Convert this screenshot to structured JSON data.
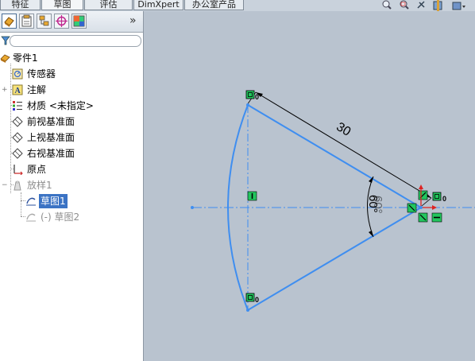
{
  "command_tabs": [
    {
      "label": "特征",
      "active": false
    },
    {
      "label": "草图",
      "active": true
    },
    {
      "label": "评估",
      "active": false
    },
    {
      "label": "DimXpert",
      "active": false
    },
    {
      "label": "办公室产品",
      "active": false
    }
  ],
  "panel_tabs": [
    {
      "icon": "feature-manager-icon",
      "active": true
    },
    {
      "icon": "property-manager-icon",
      "active": false
    },
    {
      "icon": "configuration-manager-icon",
      "active": false
    },
    {
      "icon": "dimxpert-manager-icon",
      "active": false
    },
    {
      "icon": "display-manager-icon",
      "active": false
    }
  ],
  "panel_more": "»",
  "tree": {
    "root": "零件1",
    "items": [
      {
        "label": "传感器",
        "icon": "sensor-icon"
      },
      {
        "label": "注解",
        "icon": "annotation-icon"
      },
      {
        "label": "材质 <未指定>",
        "icon": "material-icon"
      },
      {
        "label": "前视基准面",
        "icon": "plane-icon"
      },
      {
        "label": "上视基准面",
        "icon": "plane-icon"
      },
      {
        "label": "右视基准面",
        "icon": "plane-icon"
      },
      {
        "label": "原点",
        "icon": "origin-icon"
      },
      {
        "label": "放样1",
        "icon": "loft-icon",
        "muted": true
      },
      {
        "label": "草图1",
        "icon": "sketch-icon",
        "selected": true
      },
      {
        "label": "(-) 草图2",
        "icon": "sketch-icon",
        "muted": true
      }
    ]
  },
  "sketch": {
    "dimension_length": "30",
    "dimension_angle": "60°",
    "relation_label": "0",
    "line_color": "#3f8ef0",
    "relation_color": "#22c55e",
    "dimension_color": "#000000"
  },
  "view_tools": [
    "zoom-to-fit-icon",
    "zoom-area-icon",
    "previous-view-icon",
    "section-view-icon",
    "view-orientation-icon"
  ]
}
